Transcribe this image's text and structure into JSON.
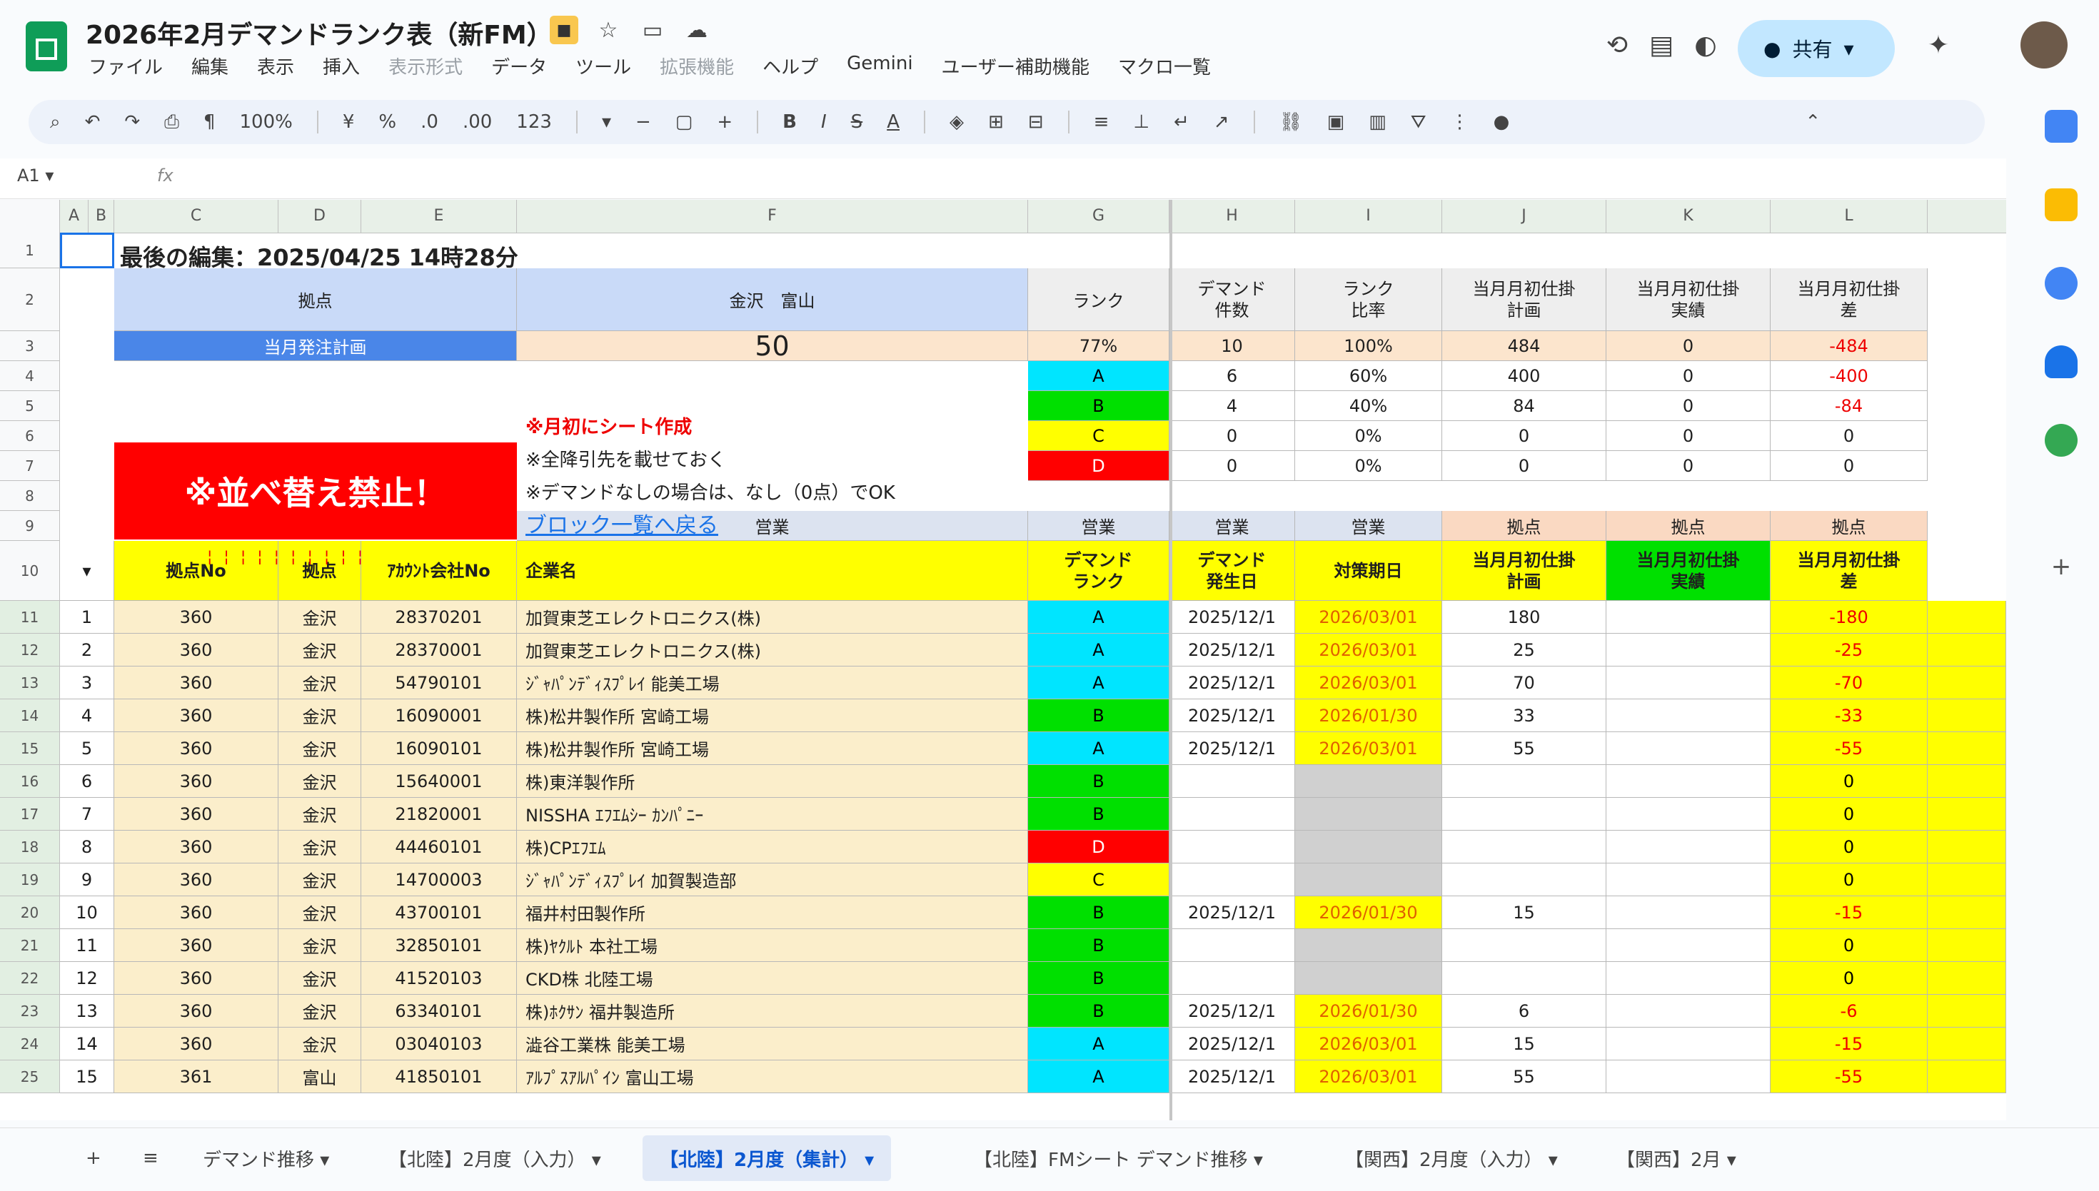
{
  "app": {
    "title": "2026年2月デマンドランク表（新FM）",
    "menu": [
      "ファイル",
      "編集",
      "表示",
      "挿入",
      "表示形式",
      "データ",
      "ツール",
      "拡張機能",
      "ヘルプ",
      "Gemini",
      "ユーザー補助機能",
      "マクロ一覧"
    ],
    "share_label": "共有",
    "zoom": "100%",
    "namebox": "A1"
  },
  "sheet": {
    "columns": [
      "A",
      "B",
      "C",
      "D",
      "E",
      "F",
      "G",
      "H",
      "I",
      "J",
      "K",
      "L"
    ],
    "last_edit": "最後の編集：2025/04/25 14時28分",
    "top_left_header": "拠点",
    "top_name_header": "金沢　富山",
    "rank_header": "ランク",
    "plan_label": "当月発注計画",
    "plan_value": "50",
    "rank_ratio": "77%",
    "right_headers": [
      "デマンド\n件数",
      "ランク\n比率",
      "当月月初仕掛\n計画",
      "当月月初仕掛\n実績",
      "当月月初仕掛\n差"
    ],
    "summary_row": [
      "10",
      "100%",
      "484",
      "0",
      "-484"
    ],
    "ranks": [
      {
        "rank": "A",
        "color": "#00e5ff",
        "vals": [
          "6",
          "60%",
          "400",
          "0",
          "-400"
        ]
      },
      {
        "rank": "B",
        "color": "#00e000",
        "vals": [
          "4",
          "40%",
          "84",
          "0",
          "-84"
        ]
      },
      {
        "rank": "C",
        "color": "#ffff00",
        "vals": [
          "0",
          "0%",
          "0",
          "0",
          "0"
        ]
      },
      {
        "rank": "D",
        "color": "#ff0000",
        "vals": [
          "0",
          "0%",
          "0",
          "0",
          "0"
        ]
      }
    ],
    "banner": "※並べ替え禁止！",
    "notes": [
      "※月初にシート作成",
      "※全降引先を載せておく",
      "※デマンドなしの場合は、なし（0点）でOK"
    ],
    "link": "ブロック一覧へ戻る",
    "section_labels": [
      "営業",
      "営業",
      "営業",
      "営業",
      "拠点",
      "拠点",
      "拠点"
    ],
    "table_headers": [
      "拠点No",
      "拠点",
      "ｱｶｳﾝﾄ会社No",
      "企業名",
      "デマンド\nランク",
      "デマンド\n発生日",
      "対策期日",
      "当月月初仕掛\n計画",
      "当月月初仕掛\n実績",
      "当月月初仕掛\n差"
    ],
    "rows": [
      {
        "n": "1",
        "code": "360",
        "base": "金沢",
        "acct": "28370201",
        "name": "加賀東芝エレクトロニクス(株)",
        "rank": "A",
        "date": "2025/12/1",
        "due": "2026/03/01",
        "plan": "180",
        "diff": "-180"
      },
      {
        "n": "2",
        "code": "360",
        "base": "金沢",
        "acct": "28370001",
        "name": "加賀東芝エレクトロニクス(株)",
        "rank": "A",
        "date": "2025/12/1",
        "due": "2026/03/01",
        "plan": "25",
        "diff": "-25"
      },
      {
        "n": "3",
        "code": "360",
        "base": "金沢",
        "acct": "54790101",
        "name": "ｼﾞｬﾊﾟﾝﾃﾞｨｽﾌﾟﾚｲ 能美工場",
        "rank": "A",
        "date": "2025/12/1",
        "due": "2026/03/01",
        "plan": "70",
        "diff": "-70"
      },
      {
        "n": "4",
        "code": "360",
        "base": "金沢",
        "acct": "16090001",
        "name": "株)松井製作所 宮崎工場",
        "rank": "B",
        "date": "2025/12/1",
        "due": "2026/01/30",
        "plan": "33",
        "diff": "-33"
      },
      {
        "n": "5",
        "code": "360",
        "base": "金沢",
        "acct": "16090101",
        "name": "株)松井製作所 宮崎工場",
        "rank": "A",
        "date": "2025/12/1",
        "due": "2026/03/01",
        "plan": "55",
        "diff": "-55"
      },
      {
        "n": "6",
        "code": "360",
        "base": "金沢",
        "acct": "15640001",
        "name": "株)東洋製作所",
        "rank": "B",
        "date": "",
        "due": "",
        "plan": "",
        "diff": "0"
      },
      {
        "n": "7",
        "code": "360",
        "base": "金沢",
        "acct": "21820001",
        "name": "NISSHA ｴﾌｴﾑｼｰ ｶﾝﾊﾟﾆｰ",
        "rank": "B",
        "date": "",
        "due": "",
        "plan": "",
        "diff": "0"
      },
      {
        "n": "8",
        "code": "360",
        "base": "金沢",
        "acct": "44460101",
        "name": "株)CPｴﾌｴﾑ",
        "rank": "D",
        "date": "",
        "due": "",
        "plan": "",
        "diff": "0"
      },
      {
        "n": "9",
        "code": "360",
        "base": "金沢",
        "acct": "14700003",
        "name": "ｼﾞｬﾊﾟﾝﾃﾞｨｽﾌﾟﾚｲ 加賀製造部",
        "rank": "C",
        "date": "",
        "due": "",
        "plan": "",
        "diff": "0"
      },
      {
        "n": "10",
        "code": "360",
        "base": "金沢",
        "acct": "43700101",
        "name": "福井村田製作所",
        "rank": "B",
        "date": "2025/12/1",
        "due": "2026/01/30",
        "plan": "15",
        "diff": "-15"
      },
      {
        "n": "11",
        "code": "360",
        "base": "金沢",
        "acct": "32850101",
        "name": "株)ﾔｸﾙﾄ 本社工場",
        "rank": "B",
        "date": "",
        "due": "",
        "plan": "",
        "diff": "0"
      },
      {
        "n": "12",
        "code": "360",
        "base": "金沢",
        "acct": "41520103",
        "name": "CKD株 北陸工場",
        "rank": "B",
        "date": "",
        "due": "",
        "plan": "",
        "diff": "0"
      },
      {
        "n": "13",
        "code": "360",
        "base": "金沢",
        "acct": "63340101",
        "name": "株)ﾎｸｻﾝ 福井製造所",
        "rank": "B",
        "date": "2025/12/1",
        "due": "2026/01/30",
        "plan": "6",
        "diff": "-6"
      },
      {
        "n": "14",
        "code": "360",
        "base": "金沢",
        "acct": "03040103",
        "name": "澁谷工業株 能美工場",
        "rank": "A",
        "date": "2025/12/1",
        "due": "2026/03/01",
        "plan": "15",
        "diff": "-15"
      },
      {
        "n": "15",
        "code": "361",
        "base": "富山",
        "acct": "41850101",
        "name": "ｱﾙﾌﾟｽｱﾙﾊﾟｲﾝ 富山工場",
        "rank": "A",
        "date": "2025/12/1",
        "due": "2026/03/01",
        "plan": "55",
        "diff": "-55"
      }
    ],
    "tabs": [
      "デマンド推移",
      "【北陸】2月度（入力）",
      "【北陸】2月度（集計）",
      "【北陸】FMシート デマンド推移",
      "【関西】2月度（入力）",
      "【関西】2月"
    ]
  },
  "colors": {
    "header_blue": "#c9daf8",
    "plan_blue": "#4a86e8",
    "peach": "#fce5cd",
    "tan": "#fbeecb",
    "yellow": "#ffff00",
    "green": "#00e000",
    "cyan": "#00e5ff",
    "red": "#ff0000",
    "gray": "#d0d0d0"
  }
}
